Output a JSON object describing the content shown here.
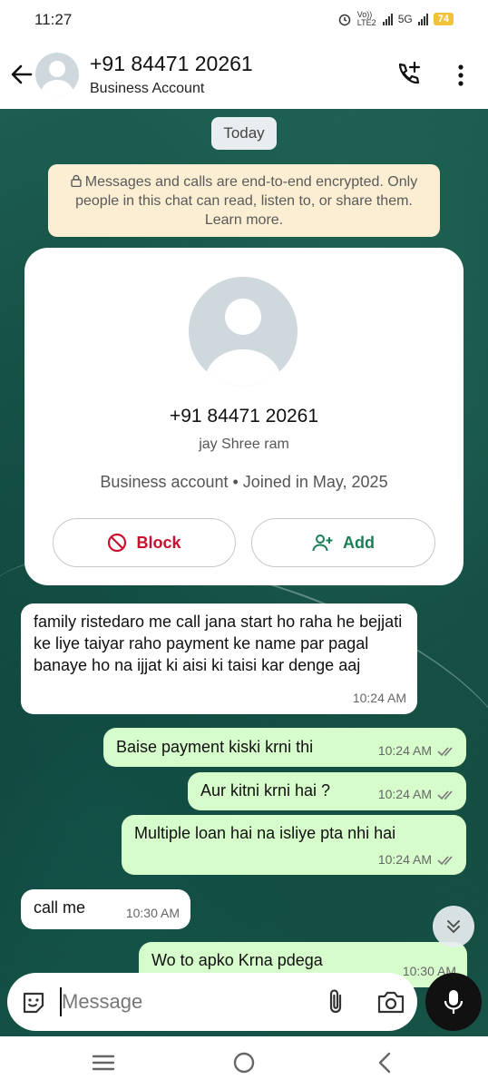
{
  "status_bar": {
    "time": "11:27",
    "volte": "Vo)) LTE2",
    "network": "5G",
    "battery": "74"
  },
  "header": {
    "title": "+91 84471 20261",
    "subtitle": "Business Account",
    "icons": [
      "back-arrow-icon",
      "avatar",
      "add-call-icon",
      "more-vert-icon"
    ]
  },
  "chat": {
    "date_chip": "Today",
    "encryption_notice": "Messages and calls are end-to-end encrypted. Only people in this chat can read, listen to, or share them. Learn more.",
    "profile_card": {
      "phone": "+91 84471 20261",
      "about": "jay Shree ram",
      "meta": "Business account • Joined in May, 2025",
      "block_label": "Block",
      "add_label": "Add"
    },
    "messages": [
      {
        "direction": "in",
        "text": "family ristedaro me call jana start ho raha he bejjati ke liye taiyar raho payment ke name par pagal banaye ho na ijjat ki aisi ki taisi kar denge aaj",
        "time": "10:24 AM"
      },
      {
        "direction": "out",
        "text": "Baise payment kiski krni thi",
        "time": "10:24 AM"
      },
      {
        "direction": "out",
        "text": "Aur kitni krni hai ?",
        "time": "10:24 AM"
      },
      {
        "direction": "out",
        "text": "Multiple loan hai na isliye pta nhi hai",
        "time": "10:24 AM"
      },
      {
        "direction": "in",
        "text": "call me",
        "time": "10:30 AM"
      },
      {
        "direction": "out",
        "text": "Wo to apko Krna pdega",
        "time": "10:30 AM"
      }
    ]
  },
  "composer": {
    "placeholder": "Message"
  },
  "colors": {
    "outgoing_bubble": "#d7fccb",
    "incoming_bubble": "#ffffff",
    "block_red": "#c8102e",
    "add_green": "#1a7f54",
    "encryption_bg": "#fbeed3"
  }
}
